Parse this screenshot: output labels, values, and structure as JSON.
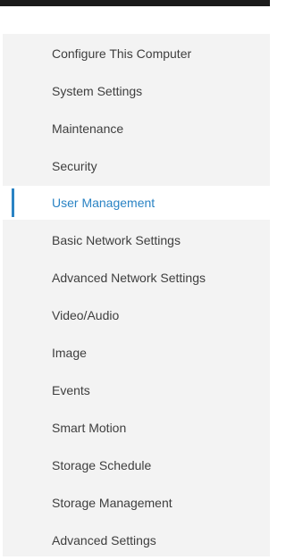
{
  "sidebar": {
    "active_index": 4,
    "items": [
      {
        "label": "Configure This Computer"
      },
      {
        "label": "System Settings"
      },
      {
        "label": "Maintenance"
      },
      {
        "label": "Security"
      },
      {
        "label": "User Management"
      },
      {
        "label": "Basic Network Settings"
      },
      {
        "label": "Advanced Network Settings"
      },
      {
        "label": "Video/Audio"
      },
      {
        "label": "Image"
      },
      {
        "label": "Events"
      },
      {
        "label": "Smart Motion"
      },
      {
        "label": "Storage Schedule"
      },
      {
        "label": "Storage Management"
      },
      {
        "label": "Advanced Settings"
      }
    ]
  },
  "colors": {
    "accent": "#2a83c4",
    "sidebar_bg": "#f3f3f3",
    "text": "#3e3e3e",
    "top_bar": "#1b1b1b"
  }
}
